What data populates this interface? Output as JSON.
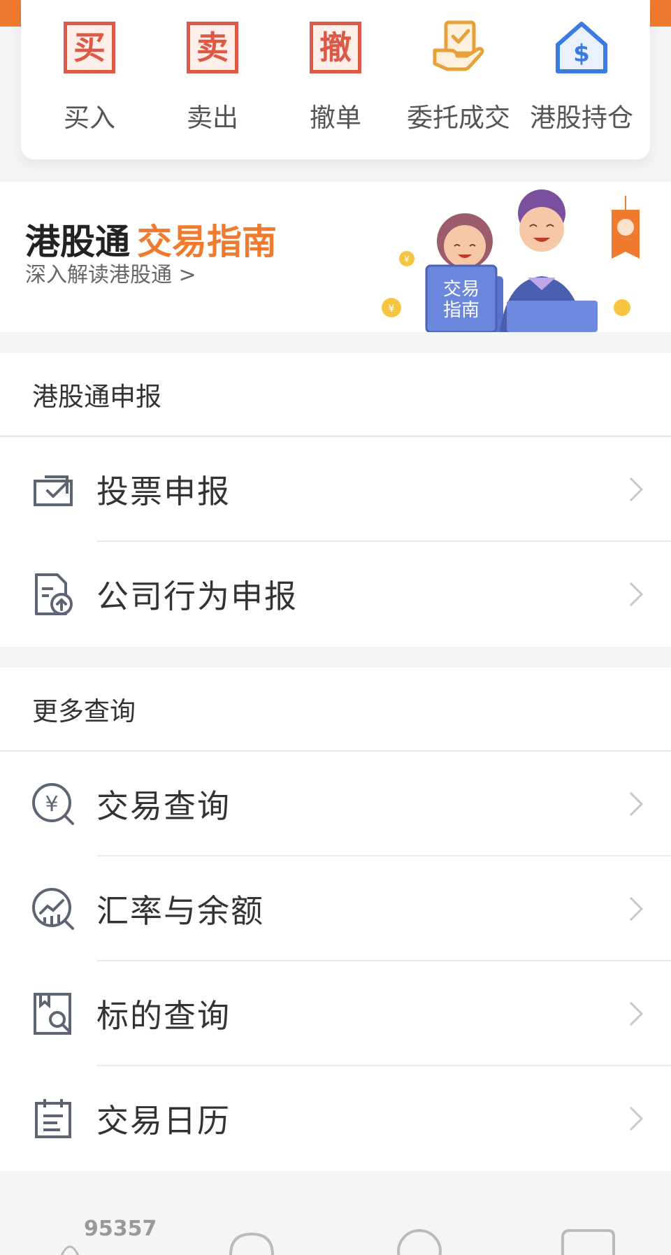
{
  "quick_actions": [
    {
      "label": "买入",
      "icon": "buy-stamp-icon",
      "glyph": "买"
    },
    {
      "label": "卖出",
      "icon": "sell-stamp-icon",
      "glyph": "卖"
    },
    {
      "label": "撤单",
      "icon": "cancel-order-stamp-icon",
      "glyph": "撤"
    },
    {
      "label": "委托成交",
      "icon": "order-deal-icon"
    },
    {
      "label": "港股持仓",
      "icon": "hk-holdings-house-icon"
    }
  ],
  "banner": {
    "title_main": "港股通",
    "title_highlight": "交易指南",
    "subtitle": "深入解读港股通",
    "subtitle_arrow": ">",
    "board_line1": "交易",
    "board_line2": "指南"
  },
  "sections": [
    {
      "title": "港股通申报",
      "items": [
        {
          "label": "投票申报",
          "icon": "vote-ballot-icon"
        },
        {
          "label": "公司行为申报",
          "icon": "document-upload-icon"
        }
      ]
    },
    {
      "title": "更多查询",
      "items": [
        {
          "label": "交易查询",
          "icon": "yuan-search-icon"
        },
        {
          "label": "汇率与余额",
          "icon": "chart-search-icon"
        },
        {
          "label": "标的查询",
          "icon": "bookmark-search-icon"
        },
        {
          "label": "交易日历",
          "icon": "calendar-icon"
        }
      ]
    }
  ],
  "bottom": {
    "hotline": "95357"
  },
  "colors": {
    "accent_orange": "#f07b2f",
    "stamp_red": "#dc5a45",
    "gold": "#e8a13a",
    "blue": "#3a7be0"
  }
}
